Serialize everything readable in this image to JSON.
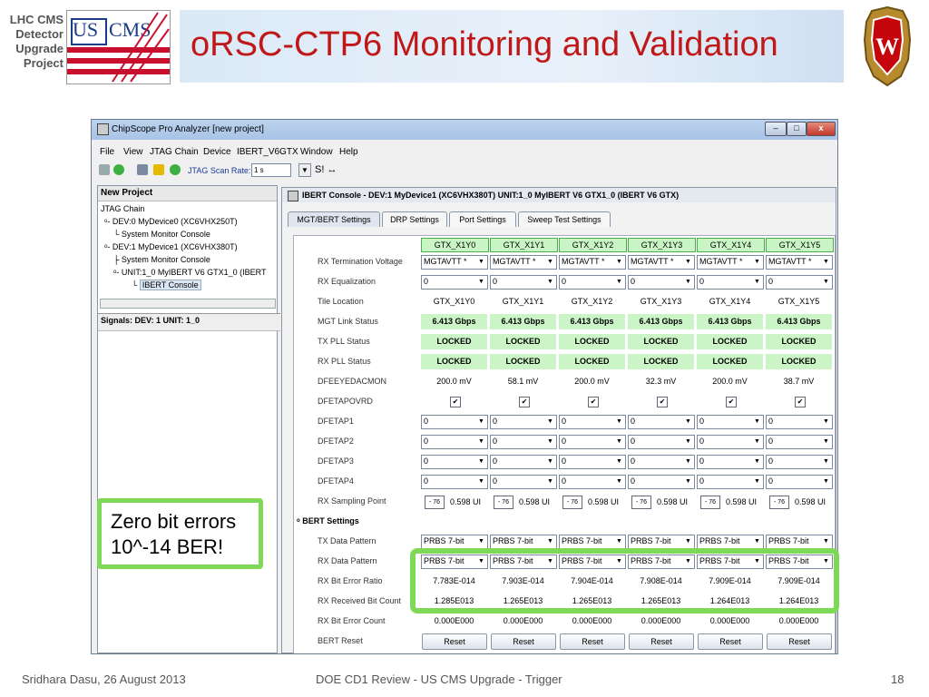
{
  "slide": {
    "lhc_lines": [
      "LHC CMS",
      "Detector",
      "Upgrade",
      "Project"
    ],
    "us_logo_text": "US",
    "cms_logo_text": "CMS",
    "title": "oRSC-CTP6 Monitoring and Validation"
  },
  "window": {
    "title": "ChipScope Pro Analyzer [new project]",
    "controls": [
      "–",
      "□",
      "x"
    ],
    "menu": [
      "File",
      "View",
      "JTAG Chain",
      "Device",
      "IBERT_V6GTX",
      "Window",
      "Help"
    ],
    "jtag_scan_rate_label": "JTAG Scan Rate:",
    "jtag_scan_rate_value": "1 s",
    "toolbar_tail": "S! ↔"
  },
  "left_panel": {
    "header": "New Project",
    "tree": [
      "JTAG Chain",
      "DEV:0 MyDevice0 (XC6VHX250T)",
      "System Monitor Console",
      "DEV:1 MyDevice1 (XC6VHX380T)",
      "System Monitor Console",
      "UNIT:1_0 MyIBERT V6 GTX1_0 (IBERT",
      "IBERT Console"
    ],
    "signals": "Signals: DEV: 1 UNIT: 1_0"
  },
  "console": {
    "title": "IBERT Console - DEV:1 MyDevice1 (XC6VHX380T) UNIT:1_0 MyIBERT V6 GTX1_0 (IBERT V6 GTX)",
    "tabs": [
      "MGT/BERT Settings",
      "DRP Settings",
      "Port Settings",
      "Sweep Test Settings"
    ],
    "columns": [
      "GTX_X1Y0",
      "GTX_X1Y1",
      "GTX_X1Y2",
      "GTX_X1Y3",
      "GTX_X1Y4",
      "GTX_X1Y5"
    ],
    "rows": [
      {
        "label": "RX Termination Voltage",
        "kind": "combo",
        "values": [
          "MGTAVTT *",
          "MGTAVTT *",
          "MGTAVTT *",
          "MGTAVTT *",
          "MGTAVTT *",
          "MGTAVTT *"
        ]
      },
      {
        "label": "RX Equalization",
        "kind": "combo",
        "values": [
          "0",
          "0",
          "0",
          "0",
          "0",
          "0"
        ]
      },
      {
        "label": "Tile Location",
        "kind": "text",
        "values": [
          "GTX_X1Y0",
          "GTX_X1Y1",
          "GTX_X1Y2",
          "GTX_X1Y3",
          "GTX_X1Y4",
          "GTX_X1Y5"
        ]
      },
      {
        "label": "MGT Link Status",
        "kind": "green",
        "values": [
          "6.413 Gbps",
          "6.413 Gbps",
          "6.413 Gbps",
          "6.413 Gbps",
          "6.413 Gbps",
          "6.413 Gbps"
        ]
      },
      {
        "label": "TX PLL Status",
        "kind": "green",
        "values": [
          "LOCKED",
          "LOCKED",
          "LOCKED",
          "LOCKED",
          "LOCKED",
          "LOCKED"
        ]
      },
      {
        "label": "RX PLL Status",
        "kind": "green",
        "values": [
          "LOCKED",
          "LOCKED",
          "LOCKED",
          "LOCKED",
          "LOCKED",
          "LOCKED"
        ]
      },
      {
        "label": "DFEEYEDACMON",
        "kind": "text",
        "values": [
          "200.0 mV",
          "58.1 mV",
          "200.0 mV",
          "32.3 mV",
          "200.0 mV",
          "38.7 mV"
        ]
      },
      {
        "label": "DFETAPOVRD",
        "kind": "check",
        "values": [
          "✔",
          "✔",
          "✔",
          "✔",
          "✔",
          "✔"
        ]
      },
      {
        "label": "DFETAP1",
        "kind": "combo",
        "values": [
          "0",
          "0",
          "0",
          "0",
          "0",
          "0"
        ]
      },
      {
        "label": "DFETAP2",
        "kind": "combo",
        "values": [
          "0",
          "0",
          "0",
          "0",
          "0",
          "0"
        ]
      },
      {
        "label": "DFETAP3",
        "kind": "combo",
        "values": [
          "0",
          "0",
          "0",
          "0",
          "0",
          "0"
        ]
      },
      {
        "label": "DFETAP4",
        "kind": "combo",
        "values": [
          "0",
          "0",
          "0",
          "0",
          "0",
          "0"
        ]
      },
      {
        "label": "RX Sampling Point",
        "kind": "spin",
        "spin_label": "- 76",
        "values": [
          "0.598 UI",
          "0.598 UI",
          "0.598 UI",
          "0.598 UI",
          "0.598 UI",
          "0.598 UI"
        ]
      },
      {
        "label": "BERT Settings",
        "kind": "section",
        "values": []
      },
      {
        "label": "TX Data Pattern",
        "kind": "combo",
        "values": [
          "PRBS 7-bit",
          "PRBS 7-bit",
          "PRBS 7-bit",
          "PRBS 7-bit",
          "PRBS 7-bit",
          "PRBS 7-bit"
        ]
      },
      {
        "label": "RX Data Pattern",
        "kind": "combo",
        "values": [
          "PRBS 7-bit",
          "PRBS 7-bit",
          "PRBS 7-bit",
          "PRBS 7-bit",
          "PRBS 7-bit",
          "PRBS 7-bit"
        ]
      },
      {
        "label": "RX Bit Error Ratio",
        "kind": "text",
        "values": [
          "7.783E-014",
          "7.903E-014",
          "7.904E-014",
          "7.908E-014",
          "7.909E-014",
          "7.909E-014"
        ]
      },
      {
        "label": "RX Received Bit Count",
        "kind": "text",
        "values": [
          "1.285E013",
          "1.265E013",
          "1.265E013",
          "1.265E013",
          "1.264E013",
          "1.264E013"
        ]
      },
      {
        "label": "RX Bit Error Count",
        "kind": "text",
        "values": [
          "0.000E000",
          "0.000E000",
          "0.000E000",
          "0.000E000",
          "0.000E000",
          "0.000E000"
        ]
      },
      {
        "label": "BERT Reset",
        "kind": "button",
        "values": [
          "Reset",
          "Reset",
          "Reset",
          "Reset",
          "Reset",
          "Reset"
        ]
      }
    ]
  },
  "callout": {
    "lines": [
      "Zero bit errors",
      "10^-14 BER!"
    ]
  },
  "footer": {
    "left": "Sridhara Dasu, 26 August 2013",
    "center": "DOE CD1 Review - US CMS Upgrade - Trigger",
    "page": "18"
  },
  "colors": {
    "title_red": "#c01818",
    "highlight_green": "#7ed957",
    "status_green": "#cbf5c7"
  }
}
